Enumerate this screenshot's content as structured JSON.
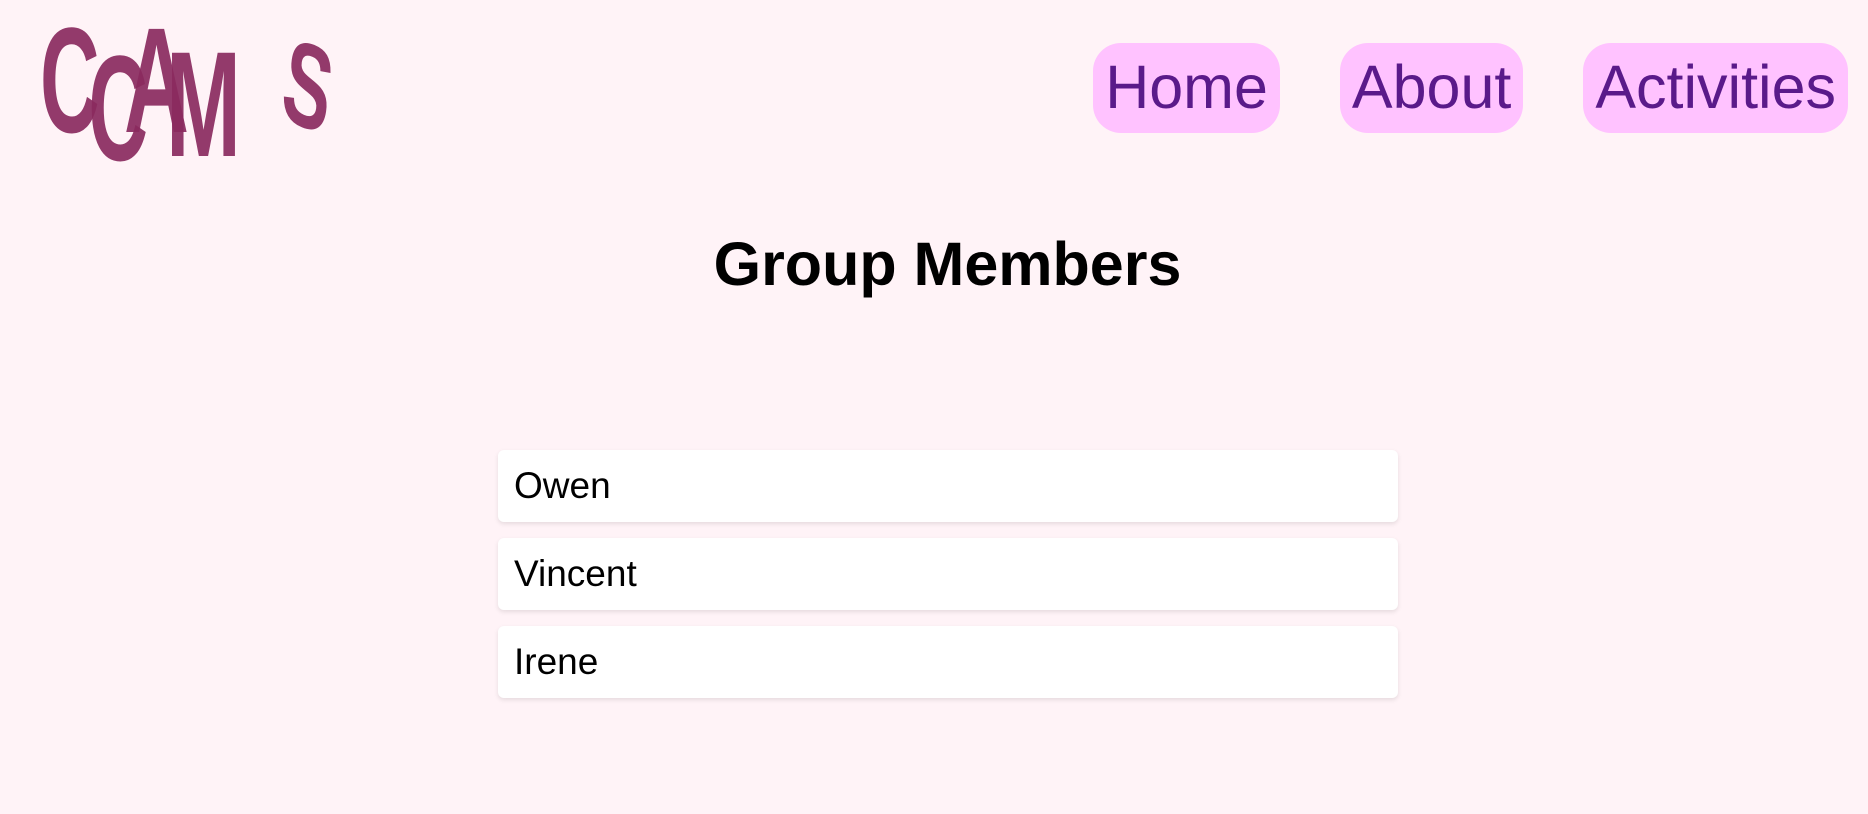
{
  "logo": {
    "text": "CCAMS",
    "color": "#8a2a5e"
  },
  "nav": {
    "items": [
      {
        "label": "Home"
      },
      {
        "label": "About"
      },
      {
        "label": "Activities"
      }
    ],
    "background": "#ffc2ff",
    "text_color": "#5a1a8a"
  },
  "page": {
    "title": "Group Members",
    "background": "#fff3f7"
  },
  "members": [
    {
      "name": "Owen"
    },
    {
      "name": "Vincent"
    },
    {
      "name": "Irene"
    }
  ]
}
